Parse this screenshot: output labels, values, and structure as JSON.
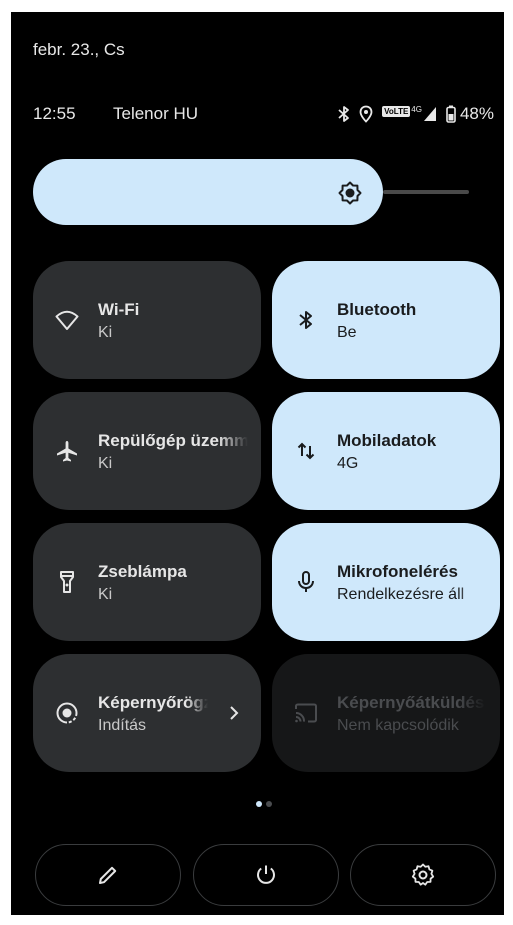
{
  "header": {
    "date": "febr. 23., Cs"
  },
  "status_bar": {
    "time": "12:55",
    "carrier": "Telenor HU",
    "volte_label": "VoLTE",
    "network_type": "4G",
    "battery": "48%",
    "icons": [
      "bluetooth-icon",
      "location-icon",
      "volte-icon",
      "signal-icon",
      "battery-icon"
    ]
  },
  "brightness": {
    "level": 0.75
  },
  "tiles": [
    {
      "title": "Wi-Fi",
      "subtitle": "Ki",
      "state": "off",
      "icon": "wifi-icon"
    },
    {
      "title": "Bluetooth",
      "subtitle": "Be",
      "state": "on",
      "icon": "bluetooth-icon"
    },
    {
      "title": "Repülőgép üzemmód",
      "subtitle": "Ki",
      "state": "off",
      "icon": "airplane-icon"
    },
    {
      "title": "Mobiladatok",
      "subtitle": "4G",
      "state": "on",
      "icon": "mobile-data-icon"
    },
    {
      "title": "Zseblámpa",
      "subtitle": "Ki",
      "state": "off",
      "icon": "flashlight-icon"
    },
    {
      "title": "Mikrofonelérés",
      "subtitle": "Rendelkezésre áll",
      "state": "on",
      "icon": "microphone-icon"
    },
    {
      "title": "Képernyőrögzítés",
      "subtitle": "Indítás",
      "state": "off",
      "icon": "screen-record-icon"
    },
    {
      "title": "Képernyőátküldés",
      "subtitle": "Nem kapcsolódik",
      "state": "disabled",
      "icon": "cast-icon"
    }
  ],
  "pager": {
    "pages": 2,
    "current": 1
  },
  "bottom_buttons": [
    "edit-icon",
    "power-icon",
    "settings-icon"
  ],
  "colors": {
    "background": "#000000",
    "tile_on": "#cfe8fb",
    "tile_off": "#2d2f31",
    "text": "#e8e8e8"
  }
}
